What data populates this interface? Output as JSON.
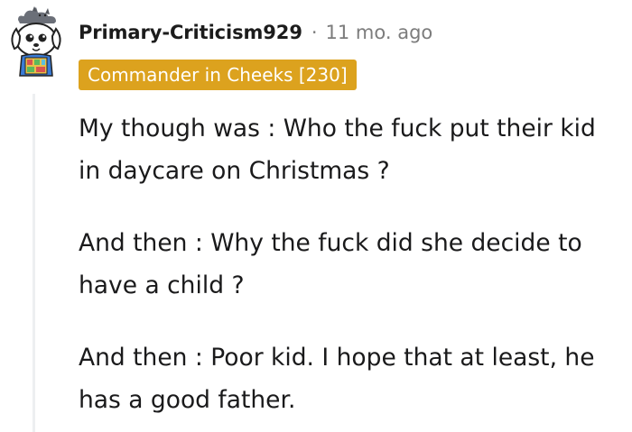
{
  "comment": {
    "author": "Primary-Criticism929",
    "separator": "·",
    "timestamp": "11 mo. ago",
    "flair": "Commander in Cheeks [230]",
    "flair_color": "#dca21e",
    "avatar_icon": "snoo-dog-avatar-icon",
    "paragraphs": [
      "My though was : Who the fuck put their kid in daycare on Christmas ?",
      "And then : Why the fuck did she decide to have a child ?",
      "And then : Poor kid. I hope that at least, he has a good father."
    ]
  }
}
